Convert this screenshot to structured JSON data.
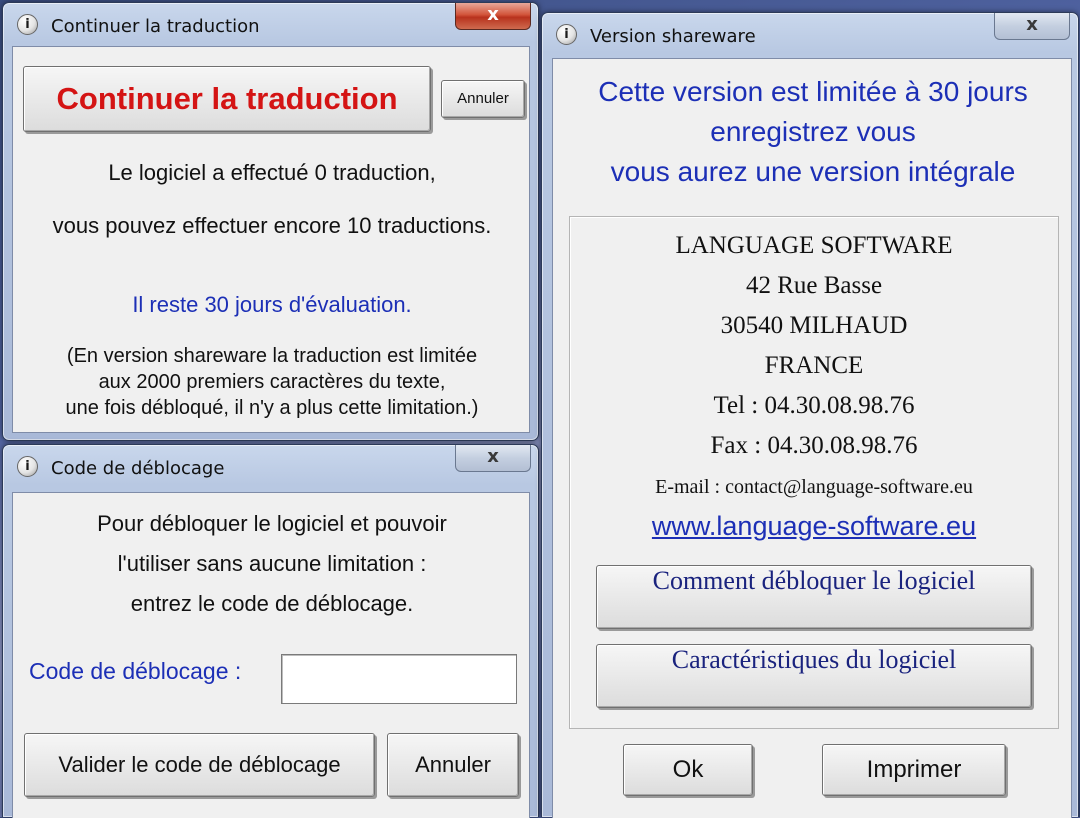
{
  "continue_window": {
    "title": "Continuer la traduction",
    "close": "x",
    "continue_button": "Continuer la traduction",
    "cancel_button": "Annuler",
    "line1": "Le logiciel a effectué 0 traduction,",
    "line2": "vous pouvez effectuer encore 10 traductions.",
    "days_left": "Il reste 30 jours d'évaluation.",
    "note1": "(En version shareware la traduction est limitée",
    "note2": "aux 2000 premiers caractères du texte,",
    "note3": "une fois débloqué, il n'y a plus cette limitation.)"
  },
  "unlock_window": {
    "title": "Code de déblocage",
    "close": "x",
    "line1": "Pour débloquer le logiciel et pouvoir",
    "line2": "l'utiliser sans aucune limitation :",
    "line3": "entrez le code de déblocage.",
    "code_label": "Code de déblocage :",
    "code_value": "",
    "validate_button": "Valider le code de déblocage",
    "cancel_button": "Annuler"
  },
  "shareware_window": {
    "title": "Version shareware",
    "close": "x",
    "headline1": "Cette version est limitée à 30 jours",
    "headline2": "enregistrez vous",
    "headline3": "vous aurez une version intégrale",
    "company": "LANGUAGE SOFTWARE",
    "street": "42 Rue Basse",
    "city": "30540 MILHAUD",
    "country": "FRANCE",
    "tel": "Tel : 04.30.08.98.76",
    "fax": "Fax : 04.30.08.98.76",
    "email": "E-mail : contact@language-software.eu",
    "website": "www.language-software.eu",
    "howto_button": "Comment débloquer le logiciel",
    "features_button": "Caractéristiques du logiciel",
    "ok_button": "Ok",
    "print_button": "Imprimer"
  },
  "colors": {
    "red_text": "#d41414",
    "blue_text": "#1c2fb6",
    "navy_text": "#1a237e"
  },
  "icons": {
    "title_icon": "info-icon"
  }
}
